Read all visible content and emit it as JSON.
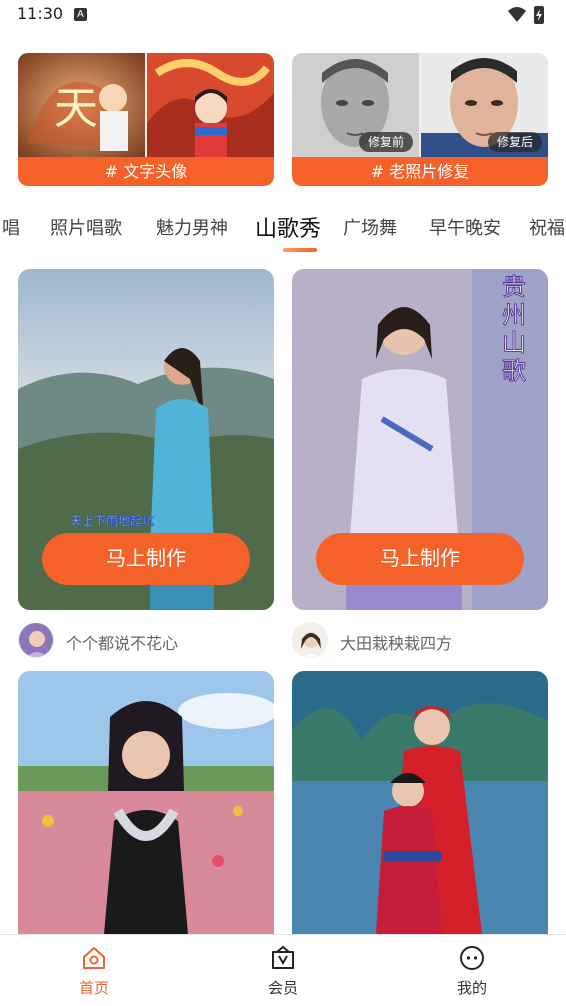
{
  "status_bar": {
    "time": "11:30",
    "notification_icon": "A"
  },
  "features": [
    {
      "tag": "# 文字头像"
    },
    {
      "tag": "# 老照片修复",
      "before_label": "修复前",
      "after_label": "修复后"
    }
  ],
  "tabs": [
    {
      "label": "唱"
    },
    {
      "label": "照片唱歌"
    },
    {
      "label": "魅力男神"
    },
    {
      "label": "山歌秀",
      "active": true
    },
    {
      "label": "广场舞"
    },
    {
      "label": "早午晚安"
    },
    {
      "label": "祝福"
    }
  ],
  "videos": [
    {
      "button": "马上制作",
      "caption": "天上下雨地起坑",
      "author": "个个都说不花心"
    },
    {
      "button": "马上制作",
      "overlay_text": "贵州山歌",
      "author": "大田栽秧栽四方"
    },
    {
      "author": ""
    },
    {
      "author": ""
    }
  ],
  "nav": [
    {
      "label": "首页",
      "icon": "home-icon",
      "active": true
    },
    {
      "label": "会员",
      "icon": "vip-bag-icon"
    },
    {
      "label": "我的",
      "icon": "profile-face-icon"
    }
  ],
  "colors": {
    "accent": "#f4622a",
    "text_primary": "#222222",
    "text_secondary": "#666666"
  }
}
